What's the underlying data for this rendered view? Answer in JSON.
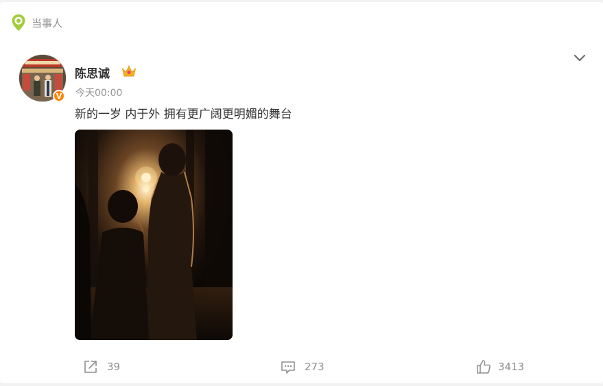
{
  "header": {
    "tag_label": "当事人",
    "tag_icon": "location-pin-icon",
    "tag_icon_color": "#a3cc3a"
  },
  "post": {
    "author": "陈思诚",
    "verified_badge": "V",
    "badge_color": "#ff8200",
    "crown_icon": "crown-icon",
    "timestamp": "今天00:00",
    "text": "新的一岁 内于外 拥有更广阔更明媚的舞台",
    "more_icon": "chevron-down-icon"
  },
  "actions": {
    "forward": {
      "icon": "share-forward-icon",
      "count": "39"
    },
    "comment": {
      "icon": "comment-icon",
      "count": "273"
    },
    "like": {
      "icon": "thumbs-up-icon",
      "count": "3413"
    }
  }
}
